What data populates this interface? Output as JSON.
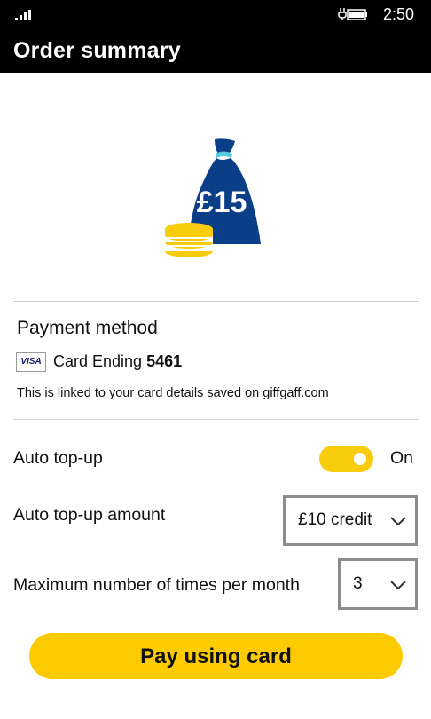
{
  "status_bar": {
    "time": "2:50",
    "signal_icon": "signal-bars-icon",
    "battery_icon": "battery-charging-icon"
  },
  "header": {
    "title": "Order summary"
  },
  "hero": {
    "amount": "£15",
    "bag_color": "#0a3e86",
    "coin_color": "#f9cc0b",
    "tie_color": "#5ac8dc"
  },
  "payment": {
    "title": "Payment method",
    "card_brand": "VISA",
    "card_prefix": "Card Ending",
    "card_last4": "5461",
    "note": "This is linked to your card details saved on giffgaff.com"
  },
  "auto_topup": {
    "label": "Auto top-up",
    "state": "On",
    "enabled": true
  },
  "auto_topup_amount": {
    "label": "Auto top-up amount",
    "value": "£10 credit"
  },
  "max_times": {
    "label": "Maximum number of times per month",
    "value": "3"
  },
  "pay_button": {
    "label": "Pay using card"
  },
  "colors": {
    "accent": "#fdcb00",
    "header_bg": "#000000"
  }
}
